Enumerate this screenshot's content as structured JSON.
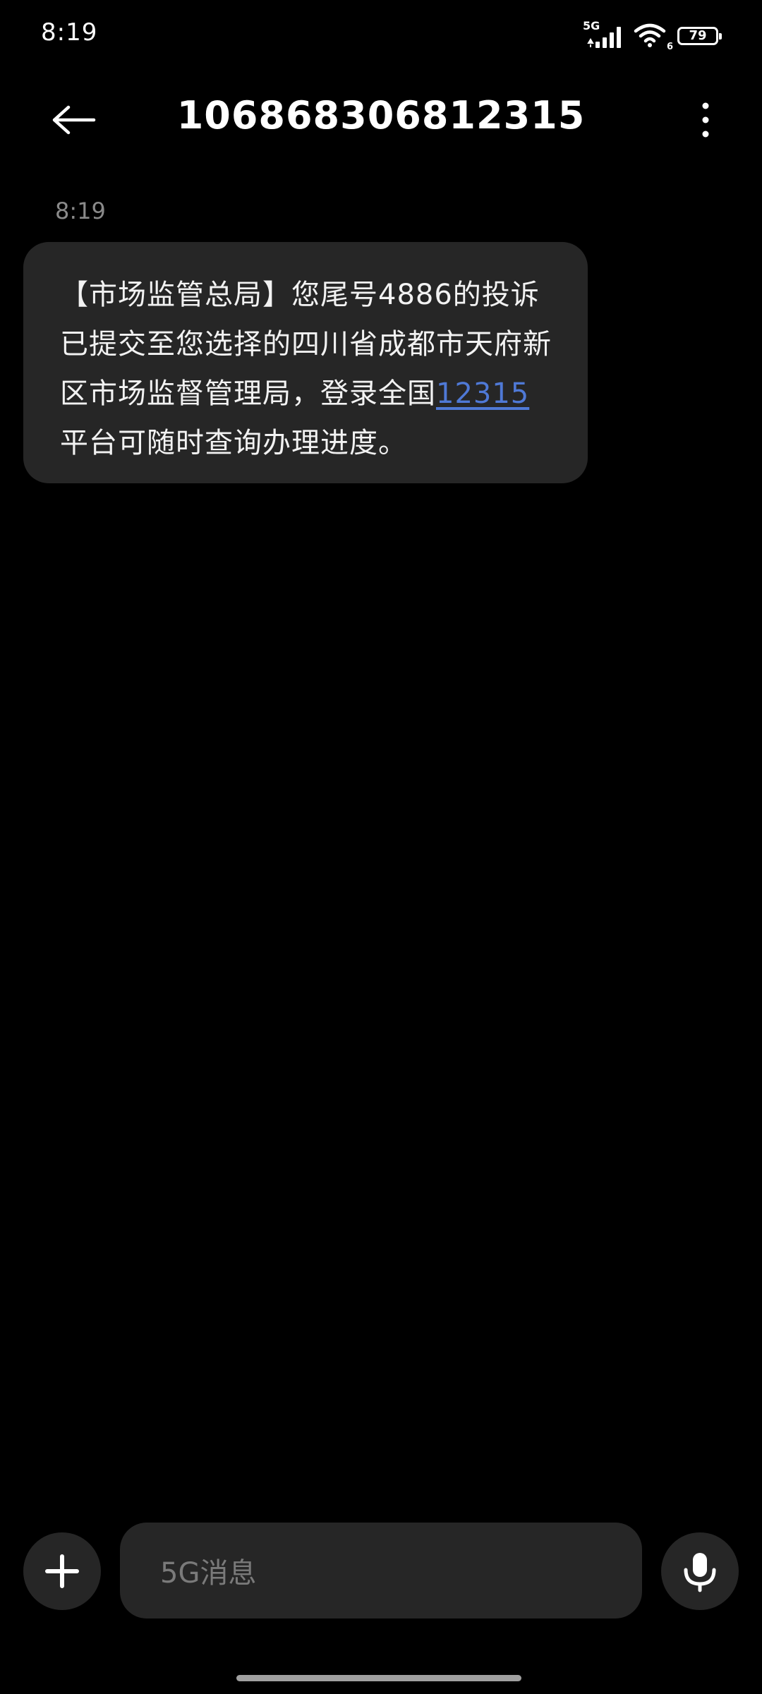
{
  "status_bar": {
    "time": "8:19",
    "network_label": "5G",
    "wifi_badge": "6",
    "battery_level": "79",
    "icons": [
      "signal-bars-icon",
      "wifi-icon",
      "battery-icon"
    ]
  },
  "header": {
    "title": "106868306812315",
    "back_icon": "arrow-left-icon",
    "more_icon": "more-vertical-icon"
  },
  "conversation": {
    "messages": [
      {
        "time": "8:19",
        "text_before_link": "【市场监管总局】您尾号4886的投诉已提交至您选择的四川省成都市天府新区市场监督管理局，登录全国",
        "link_text": "12315",
        "text_after_link": "平台可随时查询办理进度。"
      }
    ]
  },
  "input_bar": {
    "placeholder": "5G消息",
    "add_icon": "plus-icon",
    "mic_icon": "microphone-icon"
  },
  "colors": {
    "background": "#000000",
    "bubble": "#262626",
    "link": "#4f79d6",
    "secondary_text": "#8a8a8a"
  }
}
